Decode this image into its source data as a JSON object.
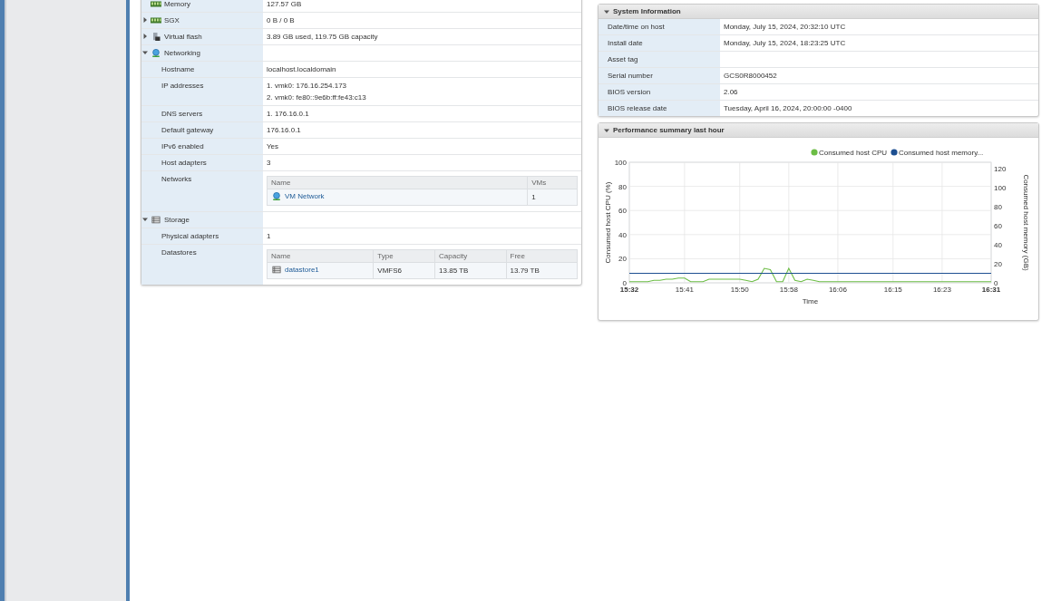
{
  "hardware": {
    "rows": [
      {
        "label": "Memory",
        "kind": "memory",
        "value": "127.57 GB"
      },
      {
        "label": "SGX",
        "kind": "memory",
        "expanded": false,
        "value": "0 B / 0 B"
      },
      {
        "label": "Virtual flash",
        "kind": "flash",
        "expanded": false,
        "value": "3.89 GB used, 119.75 GB capacity"
      },
      {
        "label": "Networking",
        "kind": "network",
        "expanded": true,
        "children": [
          {
            "label": "Hostname",
            "kind": "text",
            "value": "localhost.localdomain"
          },
          {
            "label": "IP addresses",
            "kind": "lines",
            "lines": [
              "1. vmk0: 176.16.254.173",
              "2. vmk0: fe80::9e6b:ff:fe43:c13"
            ]
          },
          {
            "label": "DNS servers",
            "kind": "text",
            "value": "1. 176.16.0.1"
          },
          {
            "label": "Default gateway",
            "kind": "text",
            "value": "176.16.0.1"
          },
          {
            "label": "IPv6 enabled",
            "kind": "text",
            "value": "Yes"
          },
          {
            "label": "Host adapters",
            "kind": "text",
            "value": "3"
          },
          {
            "label": "Networks",
            "kind": "table",
            "columns": [
              "Name",
              "VMs"
            ],
            "rows": [
              [
                "VM Network",
                "1"
              ]
            ]
          }
        ]
      },
      {
        "label": "Storage",
        "kind": "storage",
        "expanded": true,
        "children": [
          {
            "label": "Physical adapters",
            "kind": "text",
            "value": "1"
          },
          {
            "label": "Datastores",
            "kind": "table",
            "columns": [
              "Name",
              "Type",
              "Capacity",
              "Free"
            ],
            "rows": [
              [
                "datastore1",
                "VMFS6",
                "13.85 TB",
                "13.79 TB"
              ]
            ]
          }
        ]
      }
    ]
  },
  "system_information": {
    "title": "System Information",
    "expanded": true,
    "rows": [
      {
        "label": "Date/time on host",
        "value": "Monday, July 15, 2024, 20:32:10 UTC"
      },
      {
        "label": "Install date",
        "value": "Monday, July 15, 2024, 18:23:25 UTC"
      },
      {
        "label": "Asset tag",
        "value": ""
      },
      {
        "label": "Serial number",
        "value": "GCS0R8000452"
      },
      {
        "label": "BIOS version",
        "value": "2.06"
      },
      {
        "label": "BIOS release date",
        "value": "Tuesday, April 16, 2024, 20:00:00 -0400"
      }
    ]
  },
  "performance": {
    "title": "Performance summary last hour",
    "expanded": true,
    "chart_data": {
      "type": "line",
      "xlabel": "Time",
      "ylabel": "Consumed host CPU (%)",
      "y2label": "Consumed host memory (GB)",
      "y2lim": [
        0,
        127
      ],
      "y2ticks": [
        0,
        20,
        40,
        60,
        80,
        100,
        120
      ],
      "grid": true,
      "legend": "top-right",
      "categories": [
        "15:32",
        null,
        null,
        null,
        null,
        null,
        null,
        null,
        null,
        "15:41",
        null,
        null,
        null,
        null,
        null,
        null,
        null,
        null,
        "15:50",
        null,
        null,
        null,
        null,
        null,
        null,
        null,
        "15:58",
        null,
        null,
        null,
        null,
        null,
        null,
        null,
        "16:06",
        null,
        null,
        null,
        null,
        null,
        null,
        null,
        null,
        "16:15",
        null,
        null,
        null,
        null,
        null,
        null,
        null,
        "16:23",
        null,
        null,
        null,
        null,
        null,
        null,
        null,
        "16:31"
      ],
      "ylim": [
        0,
        100
      ],
      "yticks": [
        0,
        20,
        40,
        60,
        80,
        100
      ],
      "series": [
        {
          "name": "Consumed host CPU",
          "color": "#6cbd45",
          "values": [
            1,
            1,
            1,
            1,
            2,
            2,
            3,
            3,
            4,
            4,
            1,
            1,
            1,
            3,
            3,
            3,
            3,
            3,
            3,
            2,
            1,
            3,
            12,
            11,
            1,
            1,
            12,
            2,
            1,
            3,
            2,
            1,
            1,
            1,
            1,
            1,
            1,
            1,
            1,
            1,
            1,
            1,
            1,
            1,
            1,
            1,
            1,
            1,
            1,
            1,
            1,
            1,
            1,
            1,
            1,
            1,
            1,
            1,
            1,
            1
          ]
        },
        {
          "name": "Consumed host memory...",
          "color": "#1d4f91",
          "axis": "y2",
          "values": [
            10,
            10,
            10,
            10,
            10,
            10,
            10,
            10,
            10,
            10,
            10,
            10,
            10,
            10,
            10,
            10,
            10,
            10,
            10,
            10,
            10,
            10,
            10,
            10,
            10,
            10,
            10,
            10,
            10,
            10,
            10,
            10,
            10,
            10,
            10,
            10,
            10,
            10,
            10,
            10,
            10,
            10,
            10,
            10,
            10,
            10,
            10,
            10,
            10,
            10,
            10,
            10,
            10,
            10,
            10,
            10,
            10,
            10,
            10,
            10
          ]
        }
      ]
    }
  }
}
